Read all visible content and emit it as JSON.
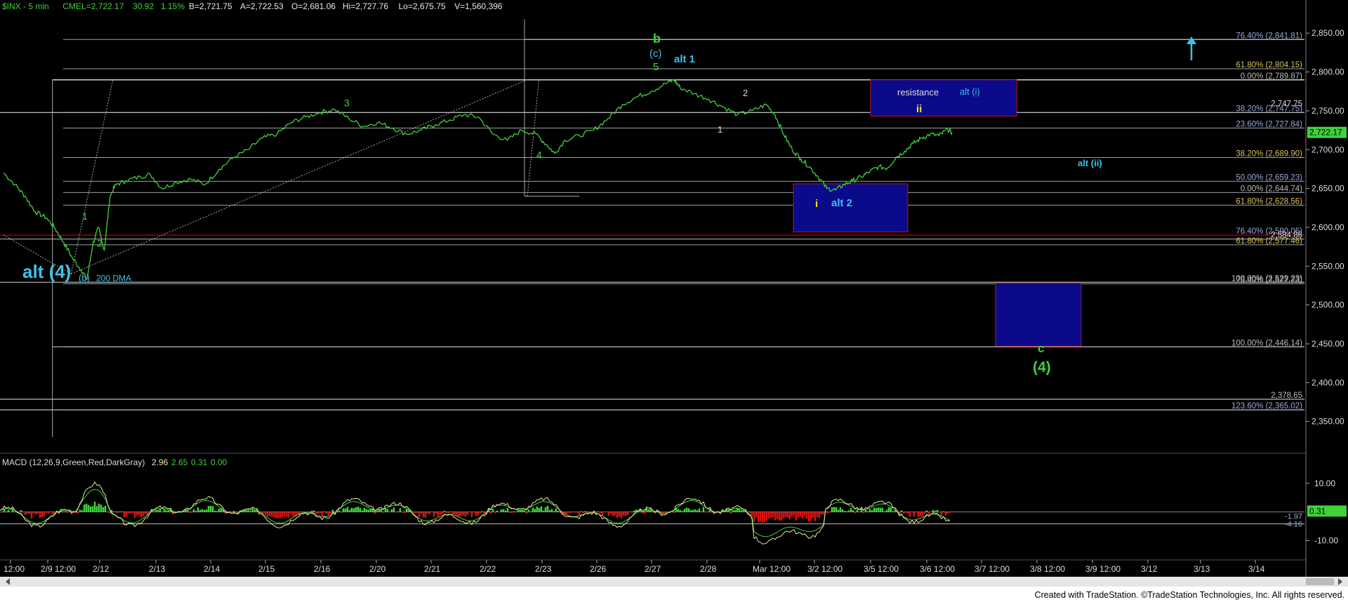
{
  "header": {
    "symbol": "$INX - 5 min",
    "exchange": "CME",
    "last": "L=2,722.17",
    "change": "30.92",
    "change_pct": "1.15%",
    "bid": "B=2,721.75",
    "ask": "A=2,722.53",
    "open": "O=2,681.06",
    "high": "Hi=2,727.76",
    "low": "Lo=2,675.75",
    "volume": "V=1,560,396"
  },
  "footer": {
    "credit": "Created with TradeStation. ©TradeStation Technologies, Inc. All rights reserved."
  },
  "colors": {
    "price": "#3fd23a",
    "cyan": "#3fc0e8",
    "green_label": "#3fd23a",
    "yellow": "#e8e820",
    "box": "#0a0a8a",
    "box_border": "#c01020",
    "fib_line": "#9aa0a6",
    "macd_line": "#e8e8a0",
    "macd_signal": "#3fd23a"
  },
  "chart_data": [
    {
      "type": "line",
      "name": "price",
      "ylim": [
        2310,
        2880
      ],
      "y_ticks": [
        "2,850.00",
        "2,800.00",
        "2,750.00",
        "2,700.00",
        "2,650.00",
        "2,600.00",
        "2,550.00",
        "2,500.00",
        "2,450.00",
        "2,400.00",
        "2,350.00"
      ],
      "y_tick_values": [
        2850,
        2800,
        2750,
        2700,
        2650,
        2600,
        2550,
        2500,
        2450,
        2400,
        2350
      ],
      "last_price_label": "2,722.17",
      "last_price": 2722.17,
      "x_labels": [
        "12:00",
        "2/9 12:00",
        "2/12",
        "2/13",
        "2/14",
        "2/15",
        "2/16",
        "2/20",
        "2/21",
        "2/22",
        "2/23",
        "2/26",
        "2/27",
        "2/28",
        "Mar 12:00",
        "3/2 12:00",
        "3/5 12:00",
        "3/6 12:00",
        "3/7 12:00",
        "3/8 12:00",
        "3/9 12:00",
        "3/12",
        "3/13",
        "3/14"
      ],
      "x_label_index": [
        0,
        4,
        6,
        10,
        14,
        18,
        22,
        26,
        30,
        34,
        38,
        42,
        46,
        50,
        54,
        58,
        62,
        66,
        70,
        74,
        78,
        82,
        86,
        90
      ],
      "price_points": [
        [
          0,
          2670
        ],
        [
          0.8,
          2655
        ],
        [
          1.5,
          2640
        ],
        [
          2.2,
          2620
        ],
        [
          3,
          2612
        ],
        [
          3.6,
          2598
        ],
        [
          4.2,
          2580
        ],
        [
          4.8,
          2560
        ],
        [
          5.4,
          2545
        ],
        [
          5.8,
          2533
        ],
        [
          6.2,
          2578
        ],
        [
          6.6,
          2600
        ],
        [
          7,
          2570
        ],
        [
          7.4,
          2640
        ],
        [
          7.8,
          2655
        ],
        [
          8.5,
          2660
        ],
        [
          9.5,
          2665
        ],
        [
          10.2,
          2668
        ],
        [
          11,
          2650
        ],
        [
          12,
          2658
        ],
        [
          13,
          2662
        ],
        [
          14,
          2655
        ],
        [
          15,
          2675
        ],
        [
          16,
          2690
        ],
        [
          17,
          2700
        ],
        [
          18,
          2715
        ],
        [
          19,
          2720
        ],
        [
          20,
          2735
        ],
        [
          21,
          2742
        ],
        [
          22,
          2748
        ],
        [
          23,
          2752
        ],
        [
          24,
          2740
        ],
        [
          25,
          2730
        ],
        [
          26,
          2735
        ],
        [
          27,
          2728
        ],
        [
          28,
          2720
        ],
        [
          29,
          2725
        ],
        [
          30,
          2732
        ],
        [
          31,
          2738
        ],
        [
          32,
          2745
        ],
        [
          33,
          2742
        ],
        [
          34,
          2720
        ],
        [
          35,
          2712
        ],
        [
          36,
          2725
        ],
        [
          37,
          2720
        ],
        [
          37.8,
          2705
        ],
        [
          38.3,
          2695
        ],
        [
          39,
          2712
        ],
        [
          40,
          2718
        ],
        [
          41,
          2725
        ],
        [
          42,
          2740
        ],
        [
          43,
          2758
        ],
        [
          44,
          2768
        ],
        [
          45,
          2775
        ],
        [
          46,
          2785
        ],
        [
          46.6,
          2790
        ],
        [
          47,
          2780
        ],
        [
          48,
          2772
        ],
        [
          49,
          2765
        ],
        [
          50,
          2755
        ],
        [
          51,
          2745
        ],
        [
          52,
          2750
        ],
        [
          53,
          2758
        ],
        [
          53.6,
          2745
        ],
        [
          54.2,
          2720
        ],
        [
          54.8,
          2700
        ],
        [
          55.4,
          2688
        ],
        [
          56,
          2678
        ],
        [
          56.6,
          2665
        ],
        [
          57.2,
          2650
        ],
        [
          57.8,
          2648
        ],
        [
          58.4,
          2655
        ],
        [
          59,
          2660
        ],
        [
          59.6,
          2665
        ],
        [
          60.2,
          2672
        ],
        [
          60.8,
          2678
        ],
        [
          61.4,
          2676
        ],
        [
          62,
          2690
        ],
        [
          62.6,
          2698
        ],
        [
          63.2,
          2708
        ],
        [
          63.8,
          2715
        ],
        [
          64.4,
          2720
        ],
        [
          65,
          2718
        ],
        [
          65.6,
          2726
        ],
        [
          65.9,
          2722
        ]
      ],
      "macd": {
        "title": "MACD (12,26,9,Green,Red,DarkGray)",
        "values_text": [
          "2.96",
          "2.65",
          "0.31",
          "0.00"
        ],
        "y_ticks": [
          "10.00",
          "-10.00"
        ],
        "y_tick_values": [
          10,
          -10
        ],
        "right_labels": [
          "-1.97",
          "-4.16",
          "0.31"
        ],
        "ylim": [
          -16,
          20
        ]
      },
      "fib_levels": [
        {
          "label": "76.40% (2,841.81)",
          "value": 2841.81
        },
        {
          "label": "61.80% (2,804.15)",
          "value": 2804.15
        },
        {
          "label": "0.00% (2,789.87)",
          "value": 2789.87
        },
        {
          "label": "38.20% (2,747.75)",
          "value": 2747.75
        },
        {
          "label": "23.60% (2,727.84)",
          "value": 2727.84
        },
        {
          "label": "38.20% (2,689.90)",
          "value": 2689.9
        },
        {
          "label": "50.00% (2,659.23)",
          "value": 2659.23
        },
        {
          "label": "0.00% (2,644.74)",
          "value": 2644.74
        },
        {
          "label": "61.80% (2,628.56)",
          "value": 2628.56
        },
        {
          "label": "76.40% (2,590.06)",
          "value": 2590.06
        },
        {
          "label": "61.80% (2,577.46)",
          "value": 2577.46
        },
        {
          "label": "100.00% (2,529.23)",
          "value": 2529.23
        },
        {
          "label": "76.40% (2,527.23)",
          "value": 2527.23
        },
        {
          "label": "100.00% (2,446.14)",
          "value": 2446.14
        },
        {
          "label": "2,378.65",
          "value": 2378.65
        },
        {
          "label": "123.60% (2,365.02)",
          "value": 2365.02
        }
      ],
      "extra_right_labels": [
        "2,747.75",
        "2,584.86"
      ],
      "annotations": [
        {
          "text": "alt (4)",
          "color": "cyan"
        },
        {
          "text": "(b)",
          "color": "cyan"
        },
        {
          "text": "200 DMA",
          "color": "cyan"
        },
        {
          "text": "1",
          "color": "green"
        },
        {
          "text": "2",
          "color": "green"
        },
        {
          "text": "3",
          "color": "green"
        },
        {
          "text": "4",
          "color": "green"
        },
        {
          "text": "b",
          "color": "green"
        },
        {
          "text": "(c)",
          "color": "cyan"
        },
        {
          "text": "5",
          "color": "green"
        },
        {
          "text": "alt 1",
          "color": "cyan"
        },
        {
          "text": "2",
          "color": "white"
        },
        {
          "text": "1",
          "color": "white"
        },
        {
          "text": "resistance",
          "color": "white"
        },
        {
          "text": "alt (i)",
          "color": "cyan"
        },
        {
          "text": "ii",
          "color": "yellow"
        },
        {
          "text": "i",
          "color": "yellow"
        },
        {
          "text": "alt 2",
          "color": "cyan"
        },
        {
          "text": "alt (ii)",
          "color": "cyan"
        },
        {
          "text": "c",
          "color": "green"
        },
        {
          "text": "(4)",
          "color": "green"
        }
      ]
    }
  ]
}
